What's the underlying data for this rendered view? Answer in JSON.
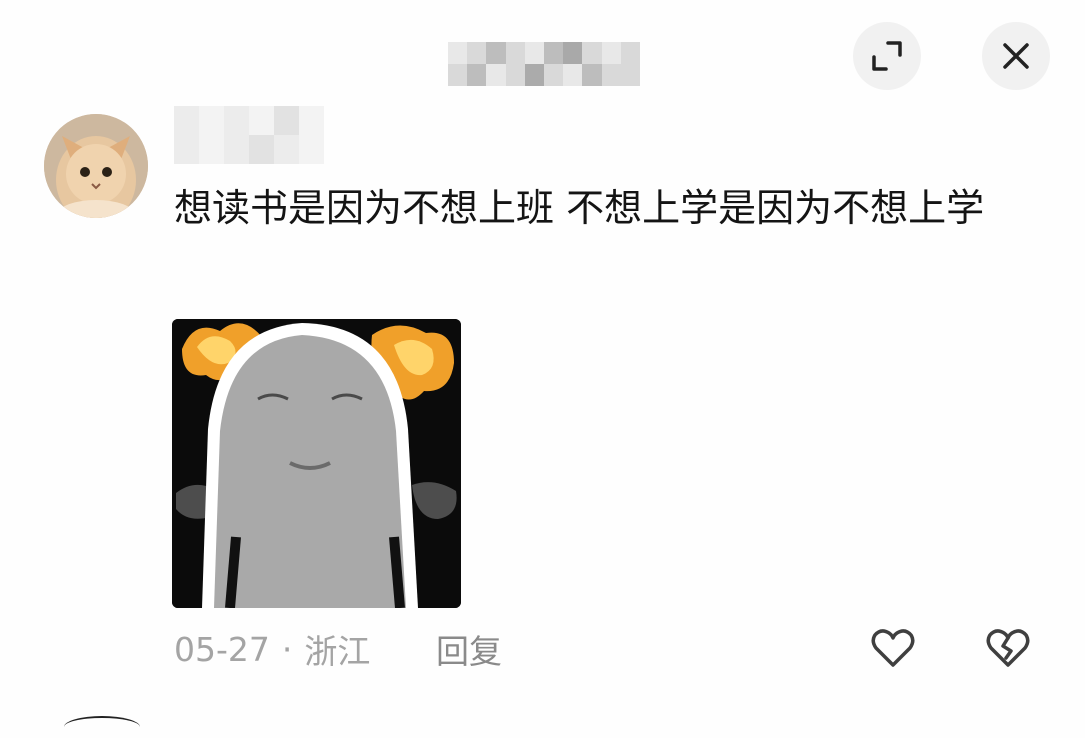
{
  "header": {
    "title_state": "blurred",
    "expand_icon": "expand-arrows-icon",
    "close_icon": "close-icon"
  },
  "comment": {
    "avatar_icon": "cat-avatar",
    "username_state": "blurred",
    "text": "想读书是因为不想上班 不想上学是因为不想上学",
    "sticker_icon": "gray-figure-sticker",
    "date": "05-27",
    "separator": "·",
    "location": "浙江",
    "reply_label": "回复",
    "like_icon": "heart-icon",
    "dislike_icon": "broken-heart-icon"
  },
  "colors": {
    "background": "#fefefe",
    "text": "#141414",
    "meta": "#a4a4a4",
    "button_bg": "#f1f1f1"
  }
}
